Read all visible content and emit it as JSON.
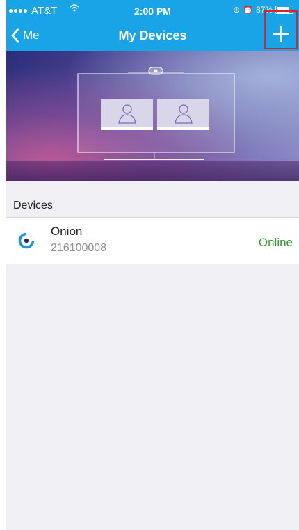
{
  "status_bar": {
    "carrier": "AT&T",
    "time": "2:00 PM",
    "battery_percent": 87,
    "battery_text": "87%"
  },
  "nav": {
    "back_label": "Me",
    "title": "My Devices"
  },
  "colors": {
    "nav_blue": "#19a4e8",
    "online_green": "#2f9e2f",
    "highlight_red": "#e32227"
  },
  "section": {
    "label": "Devices"
  },
  "devices": [
    {
      "name": "Onion",
      "id": "216100008",
      "status": "Online",
      "icon": "onion-device-icon"
    }
  ]
}
